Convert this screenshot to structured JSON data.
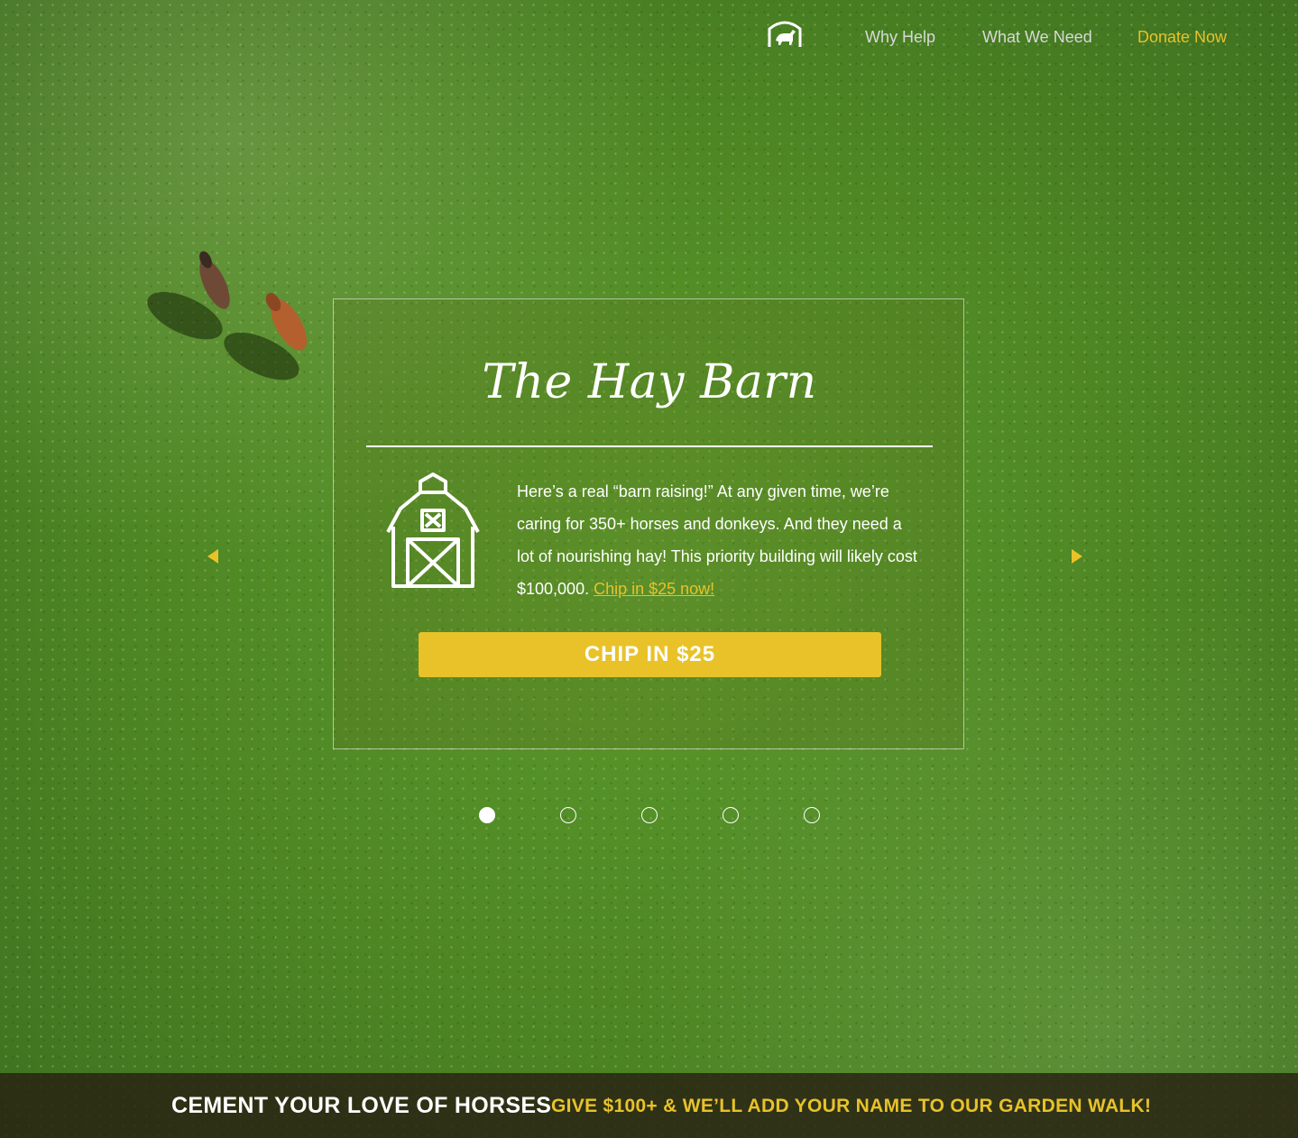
{
  "nav": {
    "logo_icon": "horse-barn-logo-icon",
    "links": [
      {
        "label": "Why Help"
      },
      {
        "label": "What We Need"
      },
      {
        "label": "Donate Now"
      }
    ]
  },
  "slide": {
    "title": "The Hay Barn",
    "icon": "barn-icon",
    "text": "Here’s a real “barn raising!” At any given time, we’re caring for 350+ horses and donkeys. And they need a lot of nourishing hay! This priority building will likely cost $100,000. ",
    "link_label": "Chip in $25 now!",
    "button_label": "CHIP IN $25"
  },
  "carousel": {
    "prev_icon": "caret-left-icon",
    "next_icon": "caret-right-icon",
    "total_slides": 5,
    "active_slide": 1
  },
  "banner": {
    "headline": "CEMENT YOUR LOVE OF HORSES",
    "offer": "GIVE $100+ & WE’LL ADD YOUR NAME TO OUR GARDEN WALK!"
  },
  "colors": {
    "accent": "#e9c229",
    "banner_bg": "#281f12",
    "text": "#ffffff"
  }
}
